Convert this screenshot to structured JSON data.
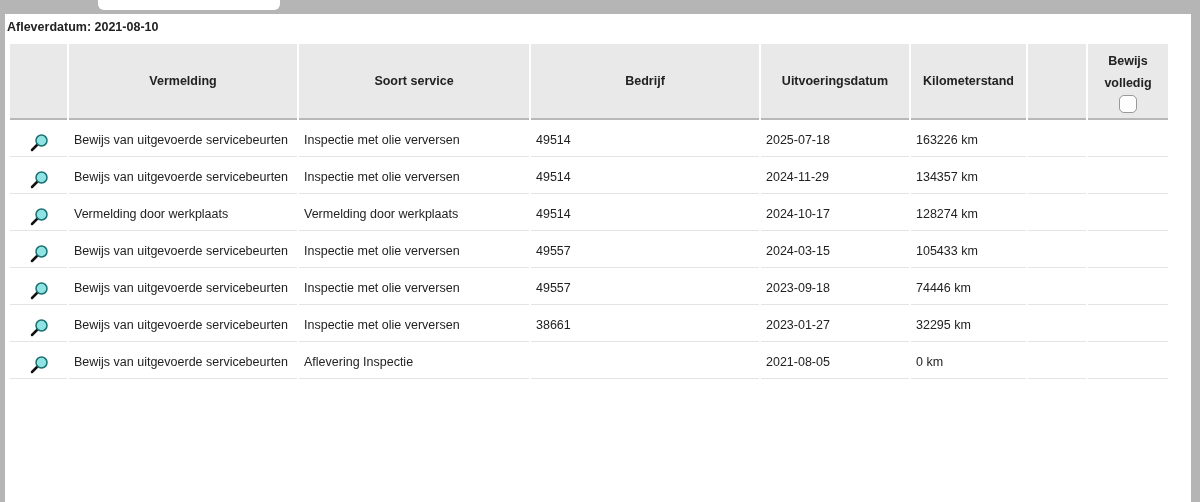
{
  "delivery_date": "Afleverdatum: 2021-08-10",
  "table": {
    "columns": [
      "Vermelding",
      "Soort service",
      "Bedrijf",
      "Uitvoeringsdatum",
      "Kilometerstand",
      "Bewijs volledig"
    ],
    "header_checkbox": {
      "checked": false
    },
    "rows": [
      {
        "vermelding": "Bewijs van uitgevoerde servicebeurten",
        "soort_service": "Inspectie met olie verversen",
        "bedrijf": "49514",
        "datum": "2025-07-18",
        "kilometerstand": "163226 km"
      },
      {
        "vermelding": "Bewijs van uitgevoerde servicebeurten",
        "soort_service": "Inspectie met olie verversen",
        "bedrijf": "49514",
        "datum": "2024-11-29",
        "kilometerstand": "134357 km"
      },
      {
        "vermelding": "Vermelding door werkplaats",
        "soort_service": "Vermelding door werkplaats",
        "bedrijf": "49514",
        "datum": "2024-10-17",
        "kilometerstand": "128274 km"
      },
      {
        "vermelding": "Bewijs van uitgevoerde servicebeurten",
        "soort_service": "Inspectie met olie verversen",
        "bedrijf": "49557",
        "datum": "2024-03-15",
        "kilometerstand": "105433 km"
      },
      {
        "vermelding": "Bewijs van uitgevoerde servicebeurten",
        "soort_service": "Inspectie met olie verversen",
        "bedrijf": "49557",
        "datum": "2023-09-18",
        "kilometerstand": "74446 km"
      },
      {
        "vermelding": "Bewijs van uitgevoerde servicebeurten",
        "soort_service": "Inspectie met olie verversen",
        "bedrijf": "38661",
        "datum": "2023-01-27",
        "kilometerstand": "32295 km"
      },
      {
        "vermelding": "Bewijs van uitgevoerde servicebeurten",
        "soort_service": "Aflevering Inspectie",
        "datum": "2021-08-05",
        "kilometerstand": "0 km"
      }
    ]
  }
}
